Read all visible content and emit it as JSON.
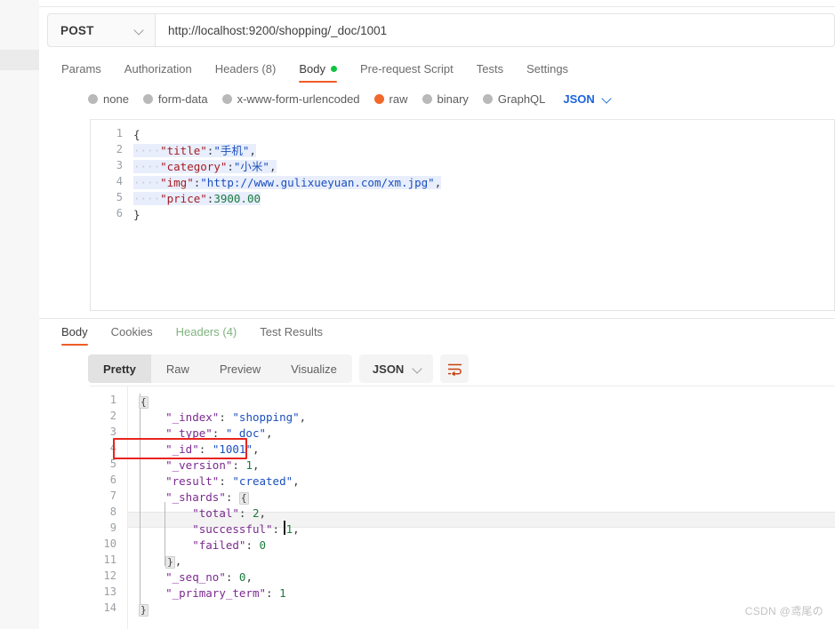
{
  "request": {
    "method": "POST",
    "url": "http://localhost:9200/shopping/_doc/1001",
    "tabs": [
      {
        "label": "Params",
        "active": false,
        "dot": false
      },
      {
        "label": "Authorization",
        "active": false,
        "dot": false
      },
      {
        "label": "Headers (8)",
        "active": false,
        "dot": false
      },
      {
        "label": "Body",
        "active": true,
        "dot": true
      },
      {
        "label": "Pre-request Script",
        "active": false,
        "dot": false
      },
      {
        "label": "Tests",
        "active": false,
        "dot": false
      },
      {
        "label": "Settings",
        "active": false,
        "dot": false
      }
    ],
    "body_types": [
      {
        "label": "none",
        "selected": false
      },
      {
        "label": "form-data",
        "selected": false
      },
      {
        "label": "x-www-form-urlencoded",
        "selected": false
      },
      {
        "label": "raw",
        "selected": true
      },
      {
        "label": "binary",
        "selected": false
      },
      {
        "label": "GraphQL",
        "selected": false
      }
    ],
    "raw_format": "JSON",
    "body_lines": [
      {
        "n": "1",
        "text": "{"
      },
      {
        "n": "2",
        "text": "    \"title\":\"手机\","
      },
      {
        "n": "3",
        "text": "    \"category\":\"小米\","
      },
      {
        "n": "4",
        "text": "    \"img\":\"http://www.gulixueyuan.com/xm.jpg\","
      },
      {
        "n": "5",
        "text": "    \"price\":3900.00"
      },
      {
        "n": "6",
        "text": "}"
      }
    ],
    "body_json": {
      "title": "手机",
      "category": "小米",
      "img": "http://www.gulixueyuan.com/xm.jpg",
      "price": "3900.00"
    }
  },
  "response": {
    "tabs": [
      {
        "label": "Body",
        "active": true
      },
      {
        "label": "Cookies",
        "active": false
      },
      {
        "label": "Headers (4)",
        "active": false
      },
      {
        "label": "Test Results",
        "active": false
      }
    ],
    "view_modes": [
      {
        "label": "Pretty",
        "active": true
      },
      {
        "label": "Raw",
        "active": false
      },
      {
        "label": "Preview",
        "active": false
      },
      {
        "label": "Visualize",
        "active": false
      }
    ],
    "format": "JSON",
    "wrap_icon": "word-wrap-icon",
    "body_lines": [
      {
        "n": "1",
        "text": "{"
      },
      {
        "n": "2",
        "text": "    \"_index\": \"shopping\","
      },
      {
        "n": "3",
        "text": "    \"_type\": \"_doc\","
      },
      {
        "n": "4",
        "text": "    \"_id\": \"1001\","
      },
      {
        "n": "5",
        "text": "    \"_version\": 1,"
      },
      {
        "n": "6",
        "text": "    \"result\": \"created\","
      },
      {
        "n": "7",
        "text": "    \"_shards\": {"
      },
      {
        "n": "8",
        "text": "        \"total\": 2,"
      },
      {
        "n": "9",
        "text": "        \"successful\": 1,"
      },
      {
        "n": "10",
        "text": "        \"failed\": 0"
      },
      {
        "n": "11",
        "text": "    },"
      },
      {
        "n": "12",
        "text": "    \"_seq_no\": 0,"
      },
      {
        "n": "13",
        "text": "    \"_primary_term\": 1"
      },
      {
        "n": "14",
        "text": "}"
      }
    ],
    "body_json": {
      "_index": "shopping",
      "_type": "_doc",
      "_id": "1001",
      "_version": 1,
      "result": "created",
      "_shards": {
        "total": 2,
        "successful": 1,
        "failed": 0
      },
      "_seq_no": 0,
      "_primary_term": 1
    },
    "highlight": {
      "line": "4",
      "field": "\"_id\": \"1001\",",
      "color": "#e8241c"
    },
    "active_line": "9"
  },
  "watermark": "CSDN @鸢尾の"
}
